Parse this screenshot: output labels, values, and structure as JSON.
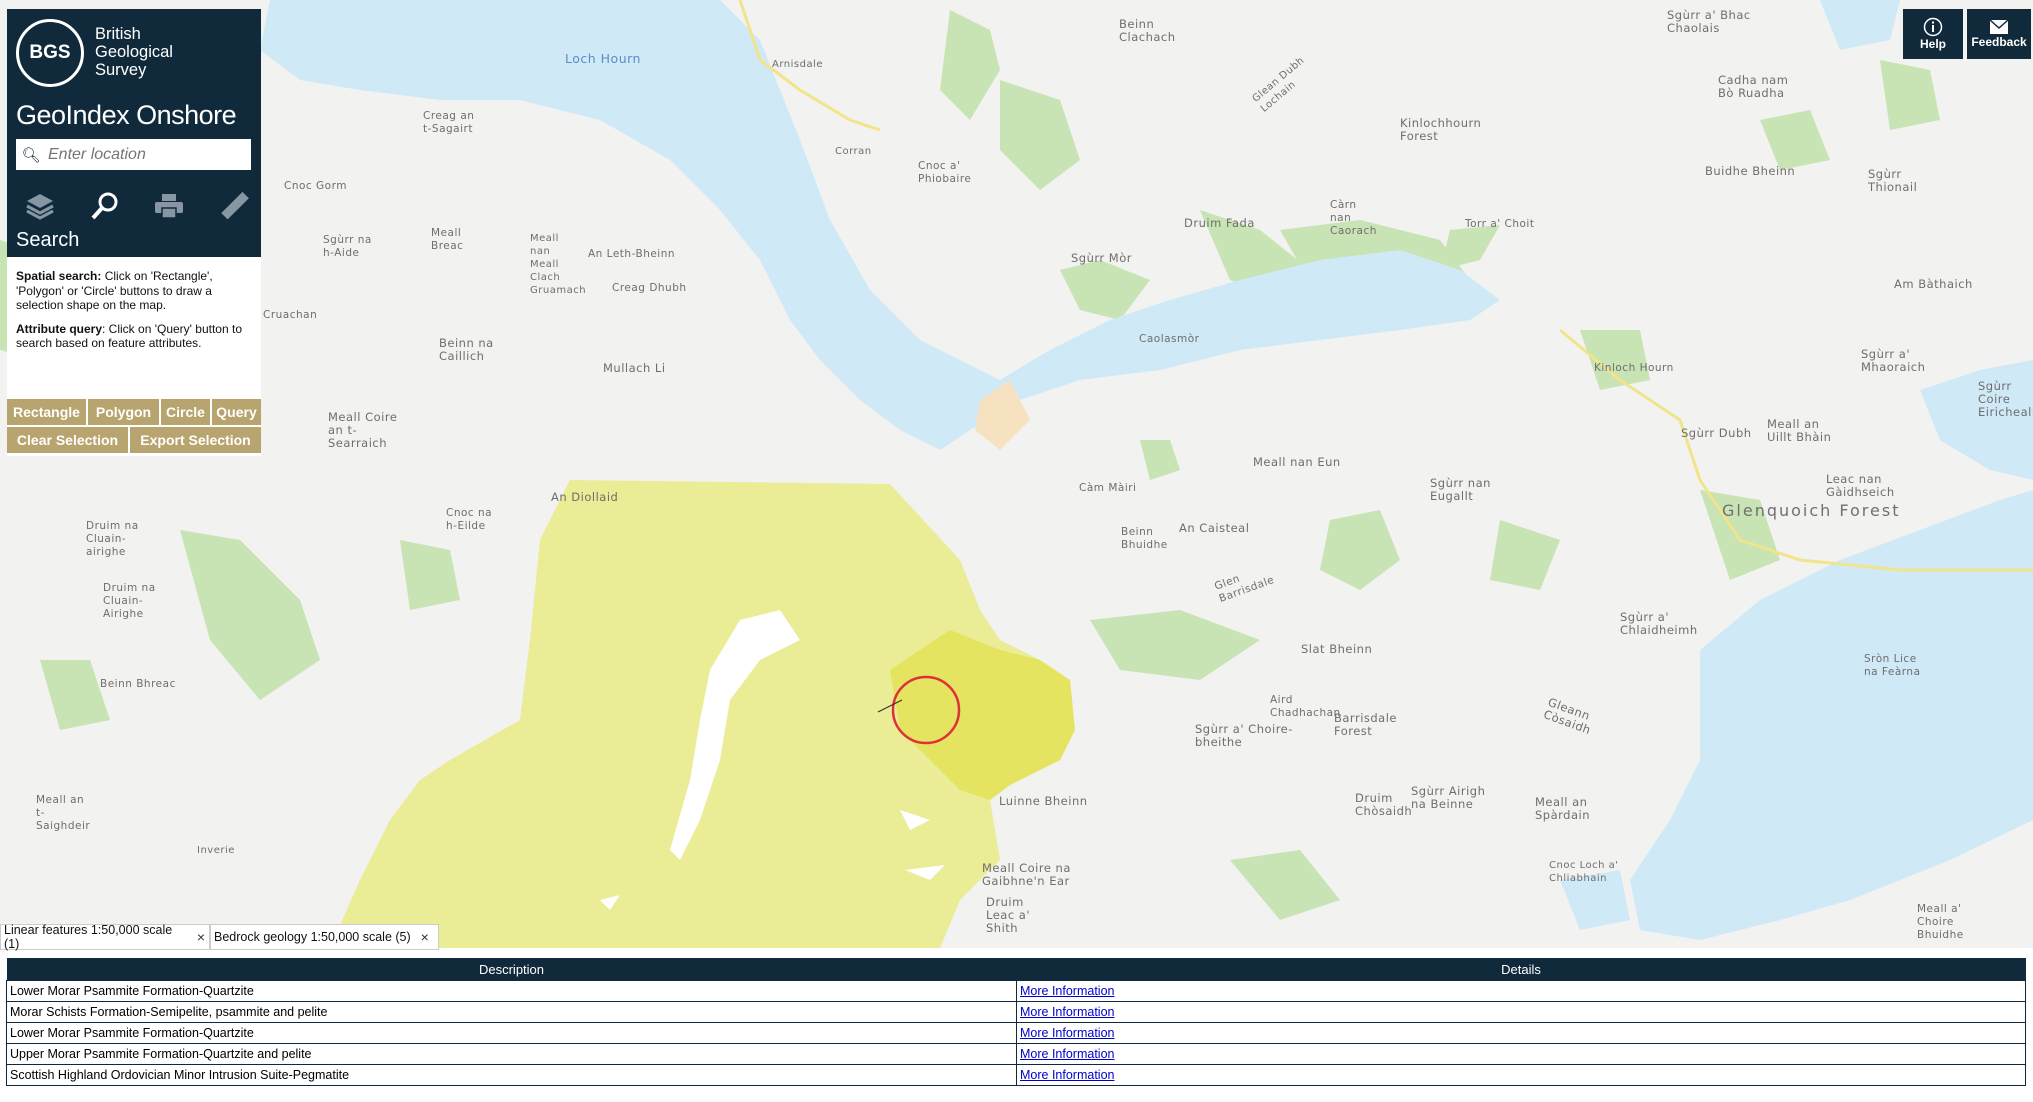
{
  "app": {
    "org_lines": [
      "British",
      "Geological",
      "Survey"
    ],
    "logo": "BGS",
    "title": "GeoIndex Onshore",
    "search_placeholder": "Enter location",
    "active_tool": "Search",
    "tool_icons": [
      "layers-icon",
      "search-icon",
      "print-icon",
      "measure-icon"
    ]
  },
  "help": {
    "spatial_title": "Spatial search:",
    "spatial_text": " Click on 'Rectangle', 'Polygon' or 'Circle' buttons to draw a selection shape on the map.",
    "attr_title": "Attribute query",
    "attr_text": ": Click on 'Query' button to search based on feature attributes."
  },
  "buttons": {
    "rectangle": "Rectangle",
    "polygon": "Polygon",
    "circle": "Circle",
    "query": "Query",
    "clear": "Clear Selection",
    "export": "Export Selection"
  },
  "top_buttons": {
    "help": "Help",
    "feedback": "Feedback"
  },
  "tabs": [
    {
      "label": "Linear features 1:50,000 scale (1)",
      "close": "×"
    },
    {
      "label": "Bedrock geology 1:50,000 scale (5)",
      "close": "×"
    }
  ],
  "table": {
    "headers": [
      "Description",
      "Details"
    ],
    "rows": [
      {
        "description": "Lower Morar Psammite Formation-Quartzite",
        "details": "More Information"
      },
      {
        "description": "Morar Schists Formation-Semipelite, psammite and pelite",
        "details": "More Information"
      },
      {
        "description": "Lower Morar Psammite Formation-Quartzite",
        "details": "More Information"
      },
      {
        "description": "Upper Morar Psammite Formation-Quartzite and pelite",
        "details": "More Information"
      },
      {
        "description": "Scottish Highland Ordovician Minor Intrusion Suite-Pegmatite",
        "details": "More Information"
      }
    ]
  },
  "map_labels": [
    "Loch Hourn",
    "Beinn Clachach",
    "Sgùrr a' Bhac Chaolais",
    "Cadha nam Bò Ruadha",
    "Arnisdale",
    "Creag an t-Sagairt",
    "Corran",
    "Cnoc a' Phiobaire",
    "Glean Dubh Lochain",
    "Kinlochhourn Forest",
    "Buidhe Bheinn",
    "Sgùrr Thionail",
    "Cnoc Gorm",
    "Sgùrr na h-Aide",
    "Meall Breac",
    "Meall nan Meall Clach Gruamach",
    "An Leth-Bheinn",
    "Creag Dhubh",
    "Sgùrr Mòr",
    "Druim Fada",
    "Càrn nan Caorach",
    "Torr a' Choit",
    "Am Bàthaich",
    "Cruachan",
    "Beinn na Caillich",
    "Mullach Li",
    "Caolasmòr",
    "Kinloch Hourn",
    "Sgùrr a' Mhaoraich",
    "Sgùrr Coire Eirichealla",
    "Meall Coire an t-Searraich",
    "Sgùrr Dubh",
    "Meall an Uillt Bhàin",
    "Meall nan Eun",
    "Sgùrr nan Eugallt",
    "Leac nan Gàidhseich",
    "Glenquoich Forest",
    "An Diollaid",
    "Càm Màiri",
    "Cnoc na h-Eilde",
    "Druim na Cluain-airighe",
    "Beinn Bhuidhe",
    "An Caisteal",
    "Druim na Cluain-Airighe",
    "Glen Barrisdale",
    "Sgùrr a' Chlaidheimh",
    "Slat Bheinn",
    "Sròn Lice na Feàrna",
    "Beinn Bhreac",
    "Aird Chadhachan",
    "Barrisdale Forest",
    "Sgùrr a' Choire-bheithe",
    "Gleann Còsaidh",
    "Meall an t-Saighdeir",
    "Luinne Bheinn",
    "Druim Chòsaidh",
    "Sgùrr Airigh na Beinne",
    "Meall an Spàrdain",
    "Inverie",
    "Meall Coire na Gaibhne'n Ear",
    "Cnoc Loch a' Chliabhain",
    "Druim Leac a' Shith",
    "Meall a' Choire Bhuidhe"
  ]
}
